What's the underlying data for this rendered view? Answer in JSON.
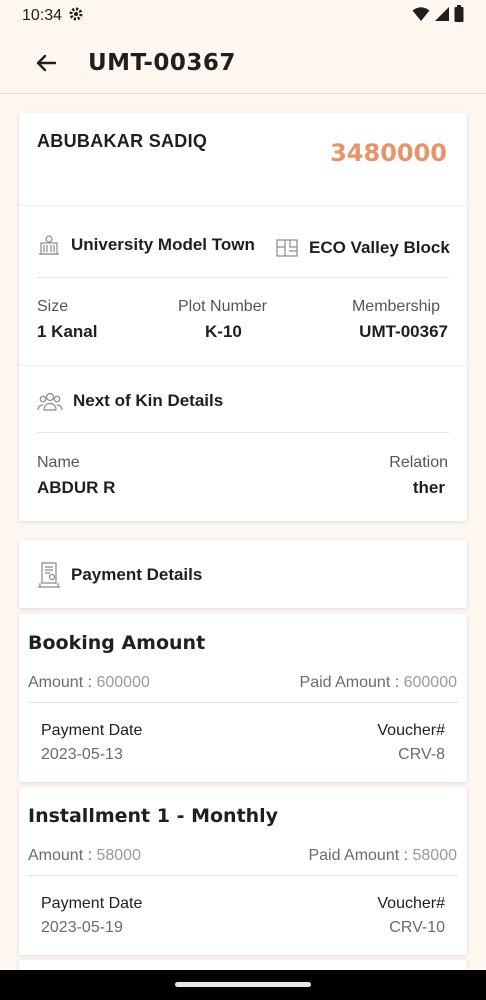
{
  "status_bar": {
    "time": "10:34"
  },
  "app_bar": {
    "title": "UMT-00367"
  },
  "owner": {
    "name": "ABUBAKAR SADIQ",
    "amount": "3480000",
    "amount_color": "#e8946a"
  },
  "location": {
    "society": "University Model Town",
    "block": "ECO Valley Block"
  },
  "plot_info": {
    "size_label": "Size",
    "size_value": "1 Kanal",
    "plot_label": "Plot Number",
    "plot_value": "K-10",
    "membership_label": "Membership",
    "membership_value": "UMT-00367"
  },
  "kin": {
    "heading": "Next of Kin Details",
    "name_label": "Name",
    "name_value": "ABDUR R",
    "relation_label": "Relation",
    "relation_value": "ther"
  },
  "payments": {
    "heading": "Payment Details",
    "items": [
      {
        "title": "Booking Amount",
        "amount_label": "Amount : ",
        "amount_value": "600000",
        "paid_label": "Paid Amount : ",
        "paid_value": "600000",
        "date_label": "Payment Date",
        "date_value": "2023-05-13",
        "voucher_label": "Voucher#",
        "voucher_value": "CRV-8"
      },
      {
        "title": "Installment 1 - Monthly",
        "amount_label": "Amount : ",
        "amount_value": "58000",
        "paid_label": "Paid Amount : ",
        "paid_value": "58000",
        "date_label": "Payment Date",
        "date_value": "2023-05-19",
        "voucher_label": "Voucher#",
        "voucher_value": "CRV-10"
      }
    ]
  }
}
